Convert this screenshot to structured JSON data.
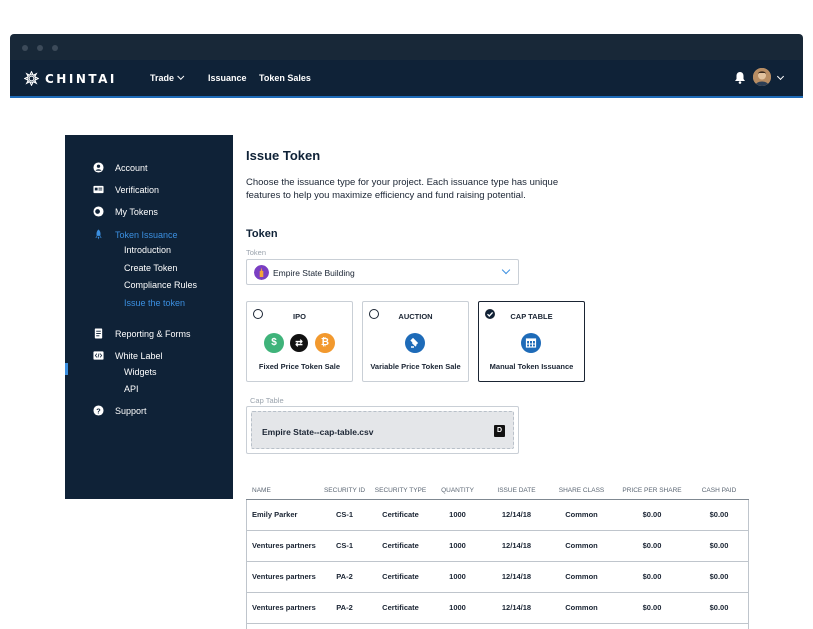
{
  "brand": {
    "name": "CHINTAI",
    "accent": "#3b8fe0",
    "nav_bg": "#0f2237"
  },
  "nav": {
    "links": [
      {
        "label": "Trade",
        "has_dropdown": true
      },
      {
        "label": "Issuance",
        "has_dropdown": false
      },
      {
        "label": "Token Sales",
        "has_dropdown": false
      }
    ],
    "icons": [
      "bell-icon",
      "avatar",
      "chevron-down-icon"
    ]
  },
  "sidebar": {
    "items": [
      {
        "label": "Account",
        "icon": "user-circle-icon"
      },
      {
        "label": "Verification",
        "icon": "id-card-icon"
      },
      {
        "label": "My Tokens",
        "icon": "tokens-icon"
      },
      {
        "label": "Token Issuance",
        "icon": "rocket-icon",
        "active": true,
        "children": [
          "Introduction",
          "Create Token",
          "Compliance Rules",
          "Issue the token"
        ]
      },
      {
        "label": "Reporting & Forms",
        "icon": "document-icon"
      },
      {
        "label": "White Label",
        "icon": "code-icon",
        "children": [
          "Widgets",
          "API"
        ]
      },
      {
        "label": "Support",
        "icon": "help-icon"
      }
    ],
    "active_child": "Issue the token"
  },
  "main": {
    "title": "Issue Token",
    "description": "Choose the issuance type for your project. Each issuance type has unique features to help you maximize efficiency and fund raising potential.",
    "token_section": "Token",
    "token_field_label": "Token",
    "token_selected": "Empire State Building",
    "issuance_types": [
      {
        "title": "IPO",
        "subtitle": "Fixed Price Token Sale",
        "selected": false,
        "icons": [
          "dollar-coin-icon",
          "exchange-icon",
          "bitcoin-icon"
        ]
      },
      {
        "title": "AUCTION",
        "subtitle": "Variable Price Token Sale",
        "selected": false,
        "icons": [
          "gavel-icon"
        ]
      },
      {
        "title": "CAP TABLE",
        "subtitle": "Manual Token Issuance",
        "selected": true,
        "icons": [
          "table-icon"
        ]
      }
    ],
    "cap_table_label": "Cap Table",
    "cap_table_file": "Empire State--cap-table.csv",
    "cap_table_file_icon": "D"
  },
  "table": {
    "headers": [
      "NAME",
      "SECURITY ID",
      "SECURITY TYPE",
      "QUANTITY",
      "ISSUE DATE",
      "SHARE CLASS",
      "PRICE PER SHARE",
      "CASH PAID"
    ],
    "rows": [
      [
        "Emily Parker",
        "CS-1",
        "Certificate",
        "1000",
        "12/14/18",
        "Common",
        "$0.00",
        "$0.00"
      ],
      [
        "Ventures partners",
        "CS-1",
        "Certificate",
        "1000",
        "12/14/18",
        "Common",
        "$0.00",
        "$0.00"
      ],
      [
        "Ventures partners",
        "PA-2",
        "Certificate",
        "1000",
        "12/14/18",
        "Common",
        "$0.00",
        "$0.00"
      ],
      [
        "Ventures partners",
        "PA-2",
        "Certificate",
        "1000",
        "12/14/18",
        "Common",
        "$0.00",
        "$0.00"
      ]
    ]
  }
}
